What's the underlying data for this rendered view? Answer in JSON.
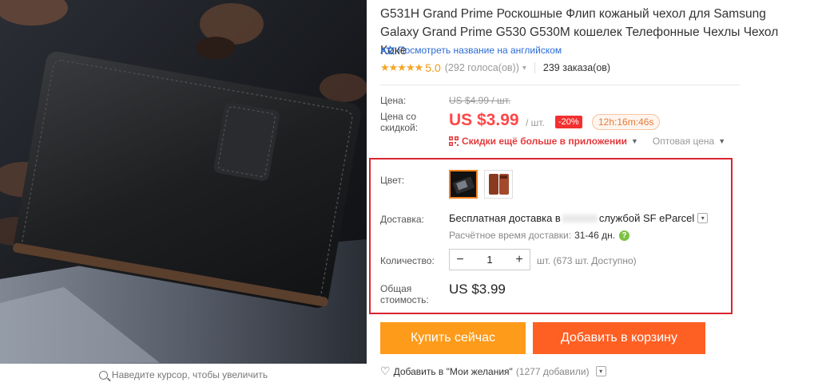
{
  "product": {
    "title": "G531H Grand Prime Роскошные Флип кожаный чехол для Samsung Galaxy Grand Prime G530 G530M кошелек Телефонные Чехлы Чехол Коке",
    "translate_icon": "A文",
    "translate_link": "Посмотреть название на английском",
    "rating": {
      "stars": "★★★★★",
      "value": "5.0",
      "votes": "(292 голоса(ов))",
      "orders": "239 заказа(ов)"
    }
  },
  "image": {
    "zoom_hint": "Наведите курсор, чтобы увеличить"
  },
  "price": {
    "label": "Цена:",
    "original": "US $4.99 / шт.",
    "discount_label": "Цена со скидкой:",
    "sale": "US $3.99",
    "per_unit": "/ шт.",
    "discount_badge": "-20%",
    "timer": "12h:16m:46s",
    "app_promo": "Скидки ещё больше в приложении",
    "wholesale": "Оптовая цена"
  },
  "options": {
    "color_label": "Цвет:",
    "colors": [
      {
        "name": "black",
        "selected": true,
        "hex": "#1c1c1c"
      },
      {
        "name": "brown",
        "selected": false,
        "hex": "#8b3a22"
      }
    ],
    "shipping_label": "Доставка:",
    "shipping_prefix": "Бесплатная доставка в",
    "shipping_suffix": "службой SF eParcel",
    "delivery_time_label": "Расчётное время доставки:",
    "delivery_days": "31-46 дн.",
    "quantity_label": "Количество:",
    "quantity": "1",
    "minus": "−",
    "plus": "+",
    "quantity_available": "шт. (673 шт. Доступно)",
    "total_label": "Общая стоимость:",
    "total": "US $3.99"
  },
  "actions": {
    "buy_now": "Купить сейчас",
    "add_to_cart": "Добавить в корзину",
    "wishlist": "Добавить в \"Мои желания\"",
    "wishlist_count": "(1277 добавили)"
  },
  "colors": {
    "accent_red": "#ff4747",
    "buy_orange": "#fe9b1b",
    "cart_orange": "#fe5f23",
    "highlight_border": "#d9252e"
  }
}
